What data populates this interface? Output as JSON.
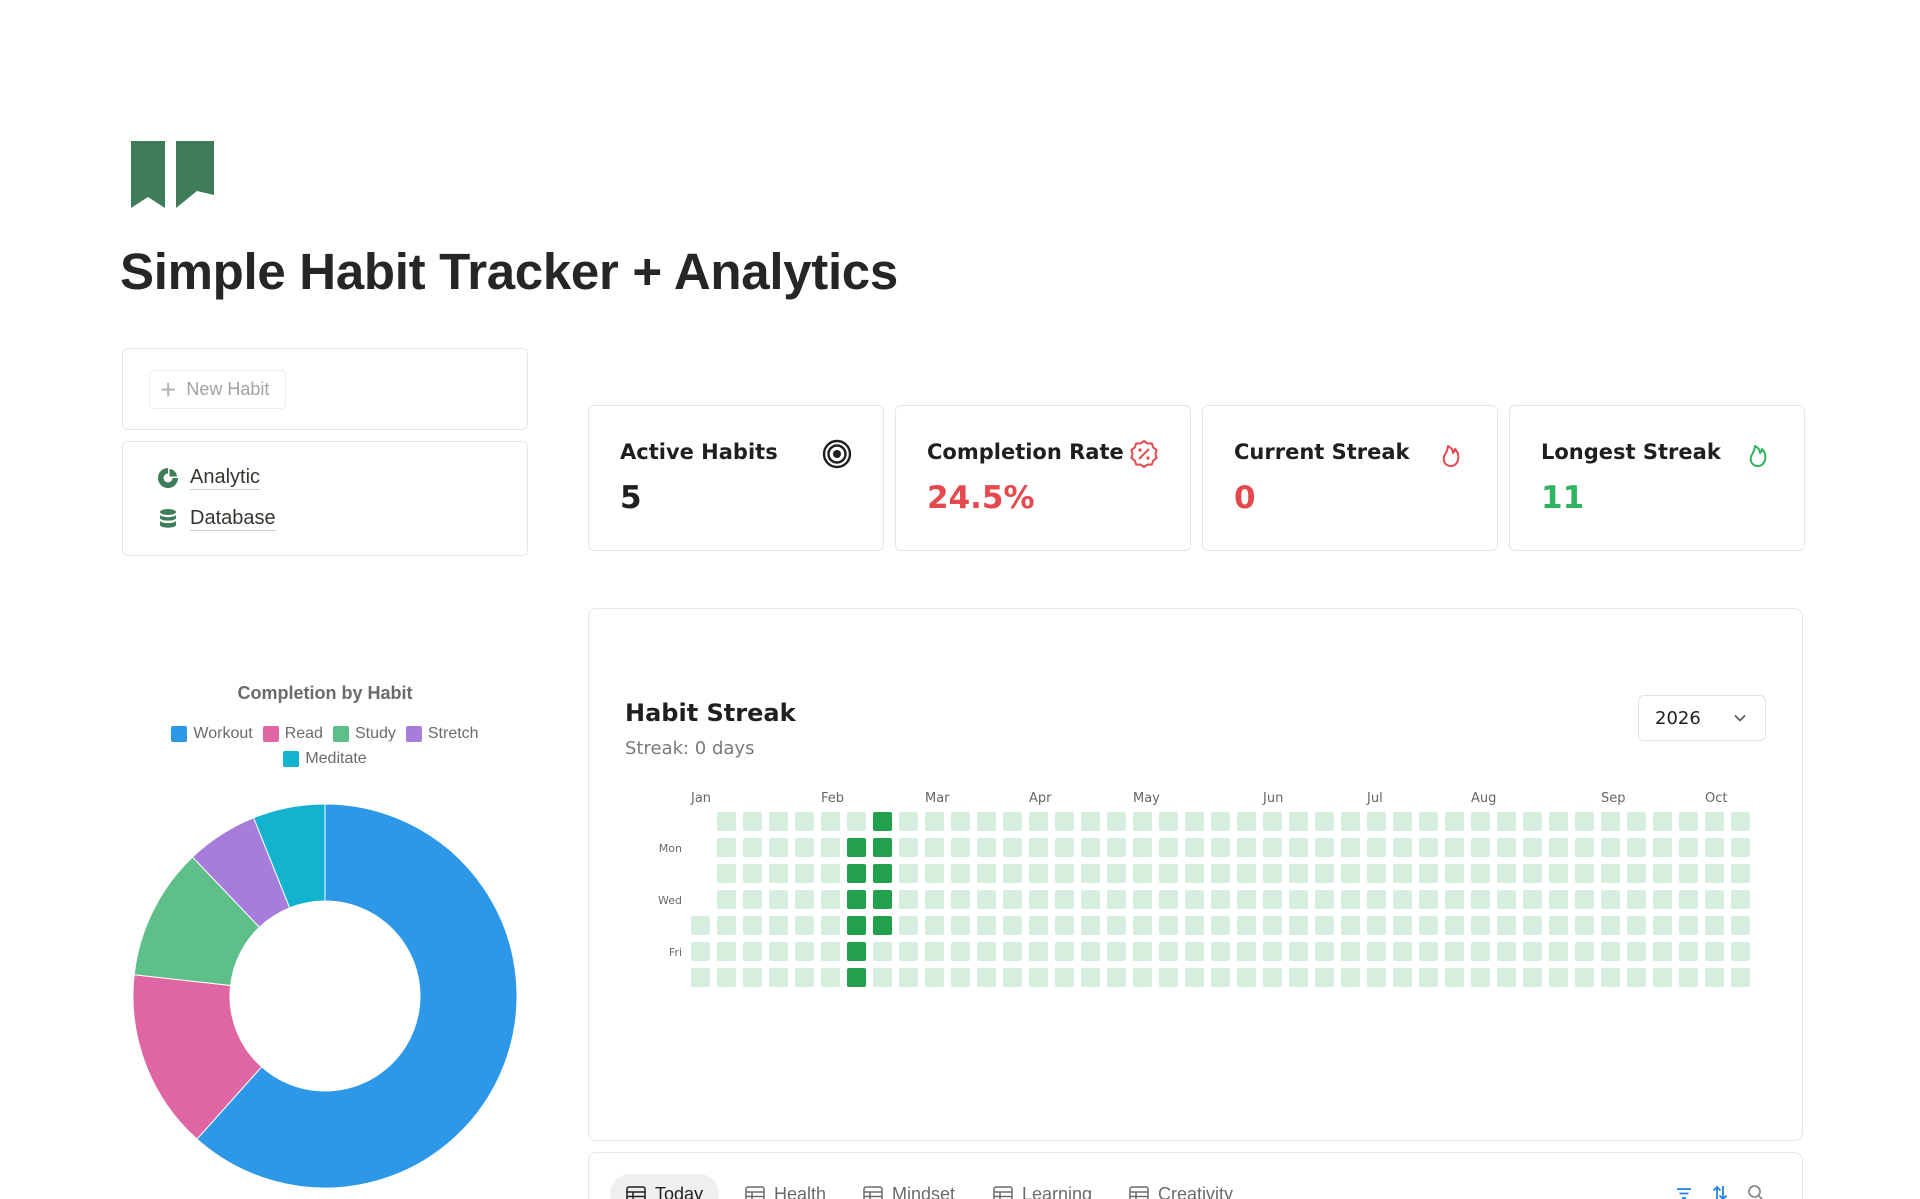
{
  "page": {
    "title": "Simple Habit Tracker + Analytics",
    "icon": "open-book-icon",
    "accent_color": "#3e7c5a"
  },
  "sidebar": {
    "new_habit_label": "New Habit",
    "links": [
      {
        "label": "Analytic",
        "icon": "pie-chart-icon"
      },
      {
        "label": "Database",
        "icon": "database-icon"
      }
    ]
  },
  "stats": [
    {
      "title": "Active Habits",
      "value": "5",
      "icon": "target-icon",
      "color": "#1f1f1f"
    },
    {
      "title": "Completion Rate",
      "value": "24.5%",
      "icon": "percent-badge-icon",
      "color": "#e5484d"
    },
    {
      "title": "Current Streak",
      "value": "0",
      "icon": "flame-icon",
      "color": "#e5484d"
    },
    {
      "title": "Longest Streak",
      "value": "11",
      "icon": "flame-icon",
      "color": "#2fb35f"
    }
  ],
  "chart_data": {
    "type": "pie",
    "title": "Completion by Habit",
    "categories": [
      "Workout",
      "Read",
      "Study",
      "Stretch",
      "Meditate"
    ],
    "values": [
      61,
      15,
      11,
      6,
      6
    ],
    "colors": [
      "#2d98e8",
      "#e066a3",
      "#5fbf89",
      "#a77ddb",
      "#11b3cf"
    ],
    "donut": true,
    "legend": "top"
  },
  "streak": {
    "title": "Habit Streak",
    "subtitle": "Streak: 0 days",
    "year": "2026",
    "months": [
      "Jan",
      "Feb",
      "Mar",
      "Apr",
      "May",
      "Jun",
      "Jul",
      "Aug",
      "Sep",
      "Oct"
    ],
    "day_labels": [
      "Mon",
      "Wed",
      "Fri"
    ],
    "empty_color": "#d6eedd",
    "active_color": "#22a04b",
    "active_cells": [
      [
        6,
        1
      ],
      [
        6,
        2
      ],
      [
        6,
        3
      ],
      [
        6,
        4
      ],
      [
        6,
        5
      ],
      [
        6,
        6
      ],
      [
        7,
        0
      ],
      [
        7,
        1
      ],
      [
        7,
        2
      ],
      [
        7,
        3
      ],
      [
        7,
        4
      ]
    ]
  },
  "tabs": [
    {
      "label": "Today",
      "icon": "table-icon",
      "active": true
    },
    {
      "label": "Health",
      "icon": "table-icon",
      "active": false
    },
    {
      "label": "Mindset",
      "icon": "table-icon",
      "active": false
    },
    {
      "label": "Learning",
      "icon": "table-icon",
      "active": false
    },
    {
      "label": "Creativity",
      "icon": "table-icon",
      "active": false
    }
  ],
  "toolbar": {
    "icons": [
      "filter-icon",
      "sort-icon",
      "search-icon"
    ],
    "color": "#2383e2"
  }
}
